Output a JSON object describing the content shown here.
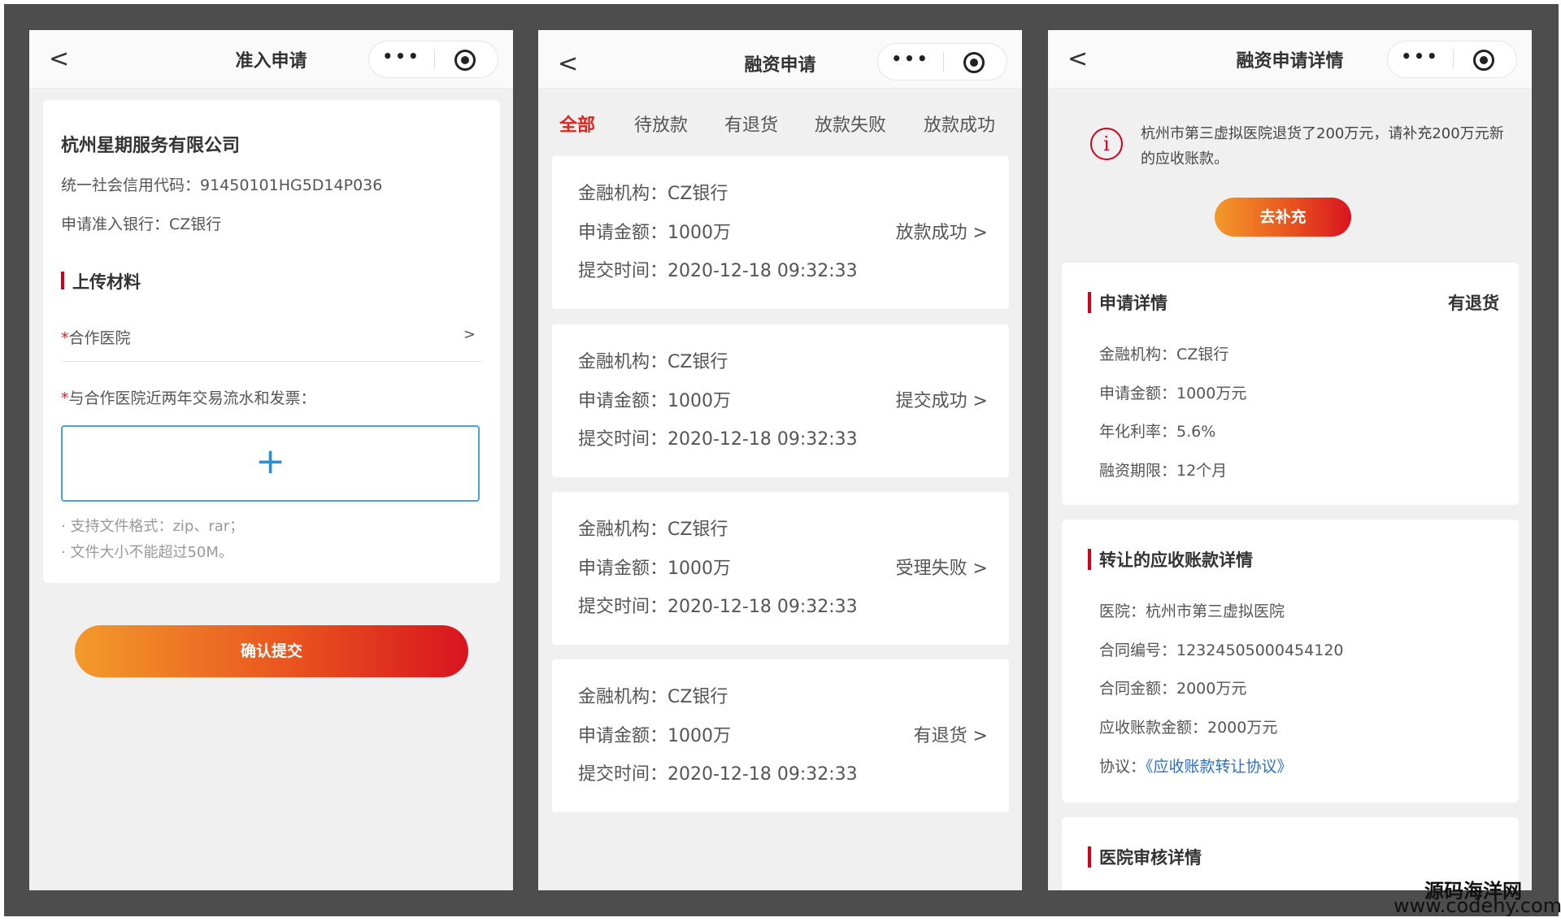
{
  "panel1": {
    "nav": {
      "back": "<",
      "title": "准入申请",
      "menu_dots": "•••"
    },
    "company": "杭州星期服务有限公司",
    "credit_code": "统一社会信用代码：91450101HG5D14P036",
    "bank": "申请准入银行：CZ银行",
    "upload_section": "上传材料",
    "hospital_field": {
      "required_mark": "*",
      "label": "合作医院",
      "arrow": ">"
    },
    "flow_label": {
      "required_mark": "*",
      "label": "与合作医院近两年交易流水和发票："
    },
    "upload_plus": "+",
    "hints": [
      "· 支持文件格式：zip、rar；",
      "· 文件大小不能超过50M。"
    ],
    "submit": "确认提交"
  },
  "panel2": {
    "nav": {
      "back": "<",
      "title": "融资申请",
      "menu_dots": "•••"
    },
    "tabs": [
      "全部",
      "待放款",
      "有退货",
      "放款失败",
      "放款成功"
    ],
    "applications": [
      {
        "institution": "金融机构：CZ银行",
        "amount": "申请金额：1000万",
        "time": "提交时间：2020-12-18 09:32:33",
        "status": "放款成功 >"
      },
      {
        "institution": "金融机构：CZ银行",
        "amount": "申请金额：1000万",
        "time": "提交时间：2020-12-18 09:32:33",
        "status": "提交成功 >"
      },
      {
        "institution": "金融机构：CZ银行",
        "amount": "申请金额：1000万",
        "time": "提交时间：2020-12-18 09:32:33",
        "status": "受理失败 >"
      },
      {
        "institution": "金融机构：CZ银行",
        "amount": "申请金额：1000万",
        "time": "提交时间：2020-12-18 09:32:33",
        "status": "有退货 >"
      }
    ]
  },
  "panel3": {
    "nav": {
      "back": "<",
      "title": "融资申请详情",
      "menu_dots": "•••"
    },
    "alert_icon": "i",
    "alert": "杭州市第三虚拟医院退货了200万元，请补充200万元新的应收账款。",
    "supplement": "去补充",
    "detail": {
      "title": "申请详情",
      "status": "有退货",
      "rows": [
        "金融机构：CZ银行",
        "申请金额：1000万元",
        "年化利率：5.6%",
        "融资期限：12个月"
      ]
    },
    "receivable": {
      "title": "转让的应收账款详情",
      "rows": [
        "医院：杭州市第三虚拟医院",
        "合同编号：12324505000454120",
        "合同金额：2000万元",
        "应收账款金额：2000万元"
      ],
      "agreement_label": "协议：",
      "agreement_link": "《应收账款转让协议》"
    },
    "hospital_review": {
      "title": "医院审核详情"
    }
  },
  "watermark": {
    "name": "源码海洋网",
    "url": "www.codehy.com"
  }
}
